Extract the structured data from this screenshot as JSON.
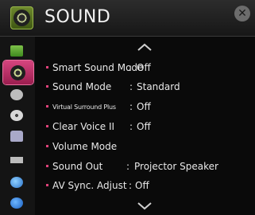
{
  "header": {
    "title": "SOUND",
    "icon": "speaker-icon",
    "close_icon": "close-icon"
  },
  "sidebar": {
    "items": [
      {
        "name": "picture",
        "icon": "picture-icon",
        "active": false
      },
      {
        "name": "sound",
        "icon": "speaker-icon",
        "active": true
      },
      {
        "name": "channel",
        "icon": "channel-icon",
        "active": false
      },
      {
        "name": "time",
        "icon": "clock-icon",
        "active": false
      },
      {
        "name": "lock",
        "icon": "lock-icon",
        "active": false
      },
      {
        "name": "option",
        "icon": "option-icon",
        "active": false
      },
      {
        "name": "network",
        "icon": "globe-icon",
        "active": false
      },
      {
        "name": "support",
        "icon": "help-icon",
        "active": false
      }
    ]
  },
  "menu": {
    "scroll_up_icon": "chevron-up-icon",
    "scroll_down_icon": "chevron-down-icon",
    "items": [
      {
        "label": "Smart Sound Mode",
        "separator": ":",
        "value": "Off"
      },
      {
        "label": "Sound Mode",
        "separator": ":",
        "value": "Standard"
      },
      {
        "label": "Virtual Surround Plus",
        "separator": ":",
        "value": "Off"
      },
      {
        "label": "Clear Voice II",
        "separator": ":",
        "value": "Off"
      },
      {
        "label": "Volume Mode",
        "separator": "",
        "value": ""
      },
      {
        "label": "Sound Out",
        "separator": ":",
        "value": "Projector Speaker"
      },
      {
        "label": "AV Sync. Adjust",
        "separator": ":",
        "value": "Off"
      }
    ]
  },
  "colors": {
    "accent": "#e0427a",
    "background": "#0a0a0a"
  }
}
